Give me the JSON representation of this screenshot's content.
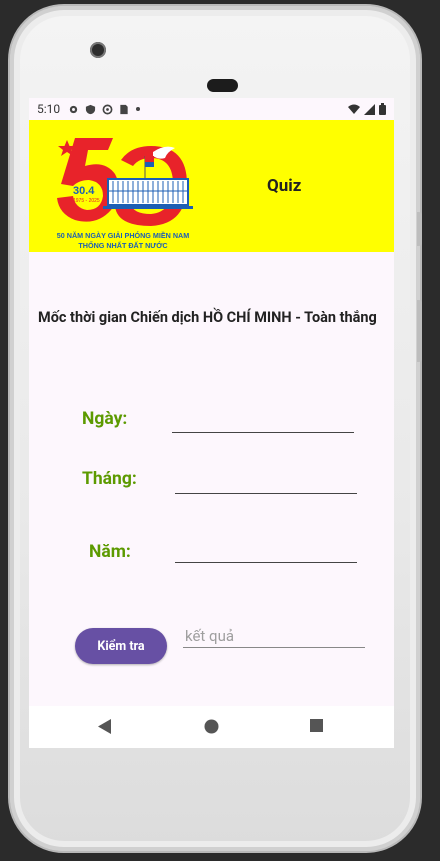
{
  "status_bar": {
    "time": "5:10"
  },
  "header": {
    "title": "Quiz",
    "logo": {
      "number": "50",
      "date": "30.4",
      "years": "1975 - 2025",
      "caption_line1": "50 NĂM NGÀY GIẢI PHÓNG MIỀN NAM",
      "caption_line2": "THỐNG NHẤT ĐẤT NƯỚC"
    }
  },
  "main": {
    "heading": "Mốc thời gian Chiến dịch HỒ CHÍ MINH - Toàn thắng",
    "day_label": "Ngày:",
    "month_label": "Tháng:",
    "year_label": "Năm:",
    "day_value": "",
    "month_value": "",
    "year_value": "",
    "check_button": "Kiểm tra",
    "result_placeholder": "kết quả"
  },
  "colors": {
    "banner_bg": "#ffff00",
    "label_green": "#5c9a00",
    "button_purple": "#6750a4",
    "logo_red": "#e8232a",
    "logo_blue": "#1d5fb4"
  },
  "icons": [
    "settings-icon",
    "shield-icon",
    "sync-icon",
    "sim-card-icon",
    "dot-icon",
    "wifi-icon",
    "signal-icon",
    "battery-icon",
    "back-nav-icon",
    "home-nav-icon",
    "recents-nav-icon"
  ]
}
